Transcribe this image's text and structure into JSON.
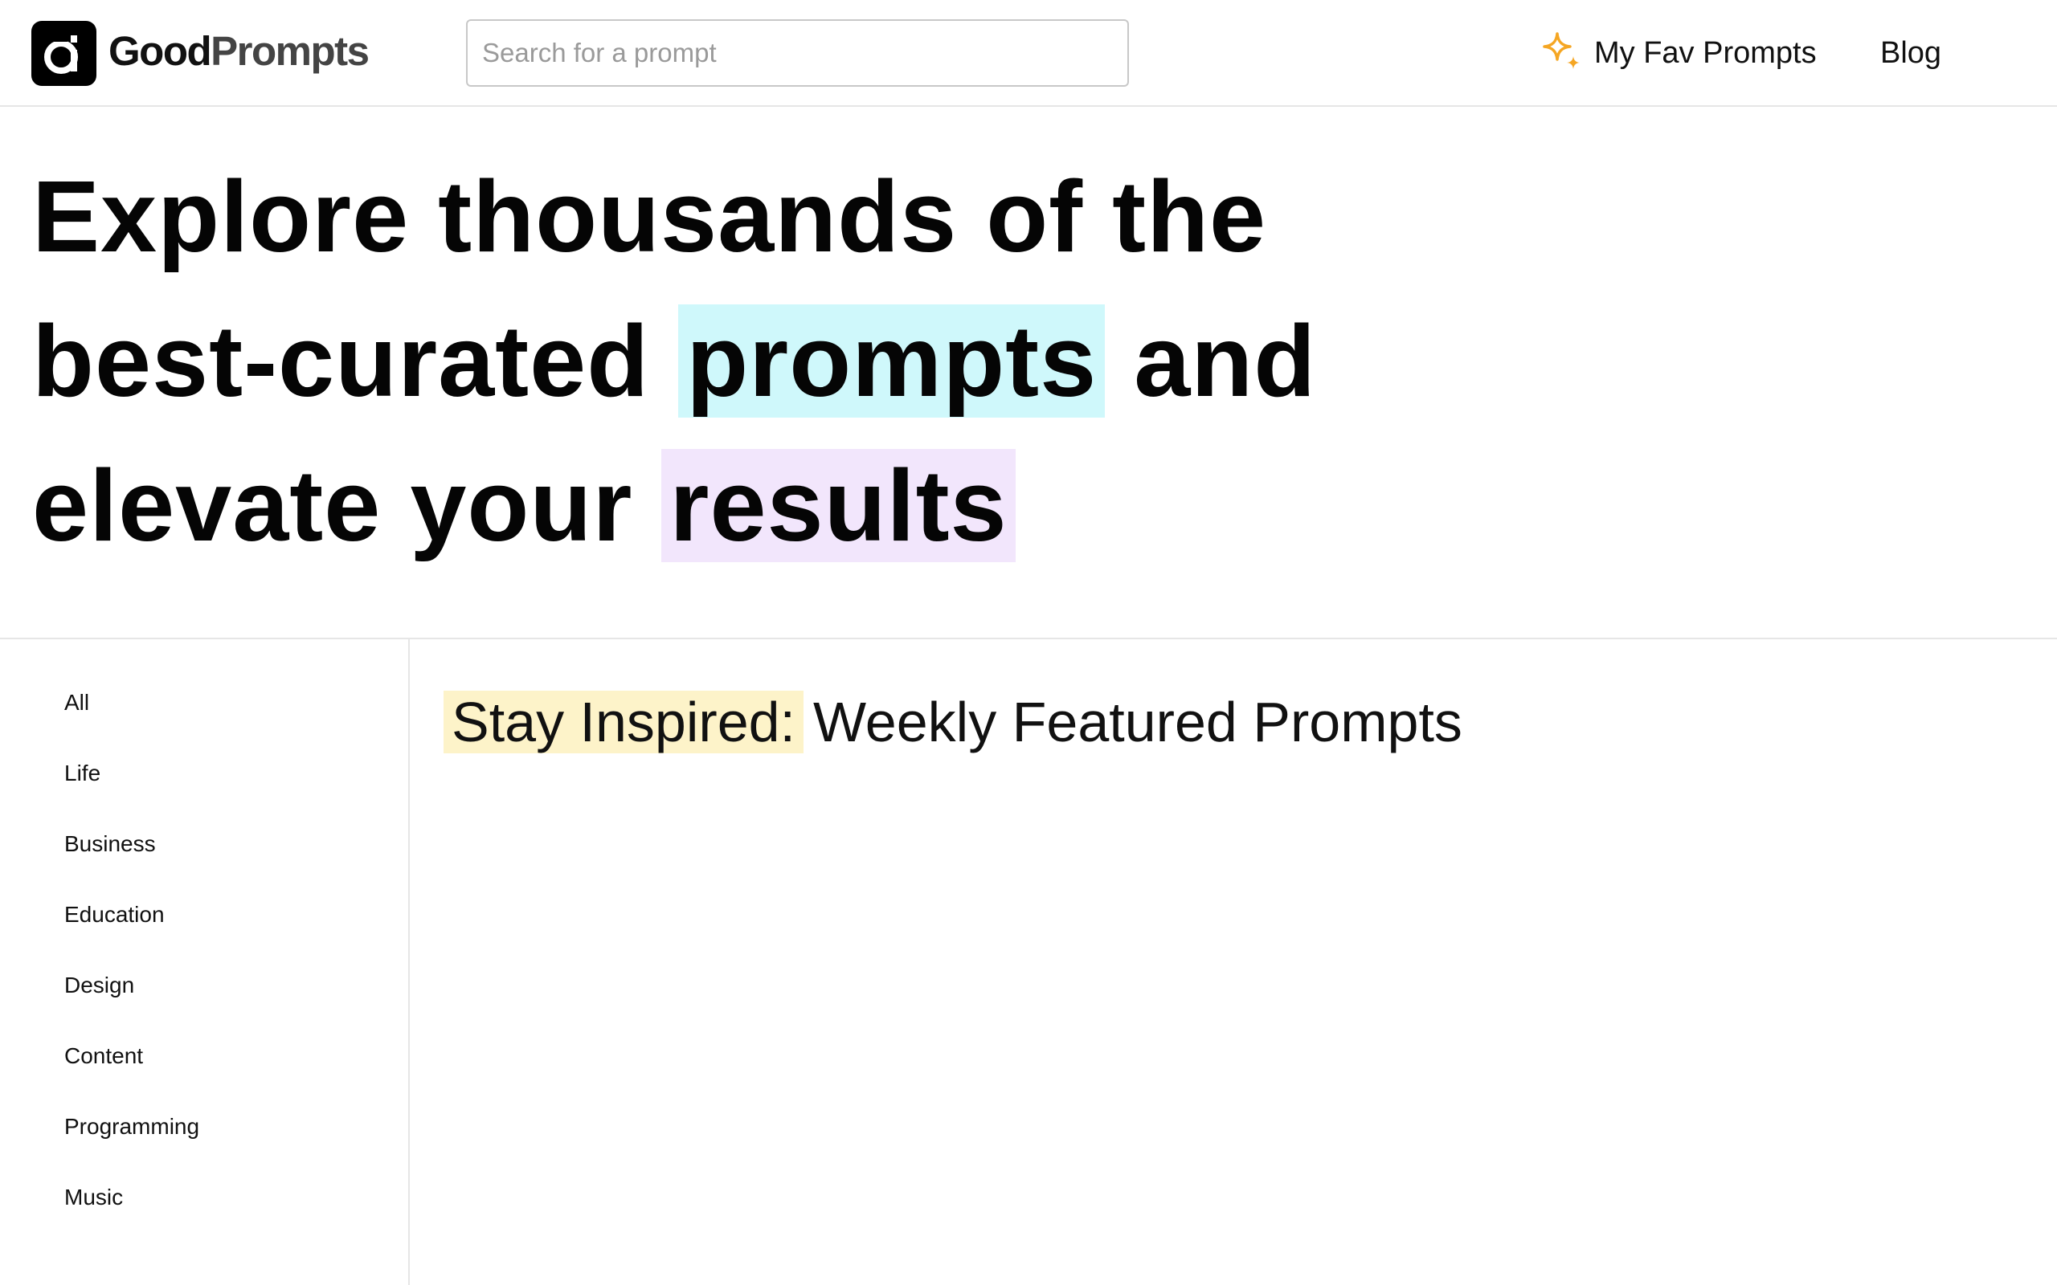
{
  "header": {
    "logo": {
      "word1": "Good",
      "word2": "Prompts",
      "icon": "good-prompts-logo-icon"
    },
    "search": {
      "placeholder": "Search for a prompt",
      "value": ""
    },
    "nav": {
      "favorites": {
        "label": "My Fav Prompts",
        "icon": "sparkle-stars-icon",
        "icon_color": "#f5a623"
      },
      "blog": {
        "label": "Blog"
      }
    }
  },
  "hero": {
    "line1": "Explore thousands of the",
    "line2_before": "best-curated",
    "line2_highlight": "prompts",
    "line2_after": "and",
    "line3_before": "elevate your",
    "line3_highlight": "results",
    "highlight_colors": {
      "prompts": "#cff8fb",
      "results": "#f2e6fc"
    }
  },
  "sidebar": {
    "categories": [
      "All",
      "Life",
      "Business",
      "Education",
      "Design",
      "Content",
      "Programming",
      "Music"
    ]
  },
  "featured": {
    "title_highlight": "Stay Inspired:",
    "title_rest": "Weekly Featured Prompts",
    "highlight_color": "#fdf3c9"
  }
}
